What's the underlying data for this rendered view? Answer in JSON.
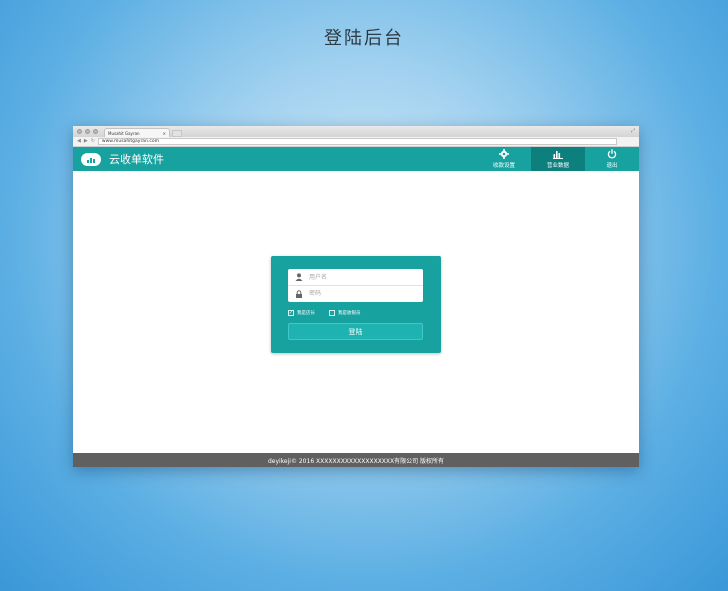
{
  "page": {
    "heading": "登陆后台"
  },
  "browser": {
    "tab_title": "Musahit Gayran",
    "tab_close": "×",
    "url": "www.musahitgayran.com"
  },
  "header": {
    "app_title": "云收单软件",
    "nav": [
      {
        "label": "收款设置",
        "icon": "gear-icon"
      },
      {
        "label": "营业数据",
        "icon": "bar-chart-icon"
      },
      {
        "label": "退出",
        "icon": "power-icon"
      }
    ],
    "active_nav": "营业数据"
  },
  "login": {
    "username_placeholder": "用户名",
    "password_placeholder": "密码",
    "role_owner": "我是店长",
    "role_cashier": "我是收银员",
    "owner_checked": true,
    "cashier_checked": false,
    "submit_label": "登陆"
  },
  "footer": {
    "text": "deyikeji©  2016  XXXXXXXXXXXXXXXXXXX有限公司 版权所有"
  },
  "colors": {
    "accent": "#17a2a0",
    "accent_dark": "#0d7f7d",
    "footer_bg": "#606060"
  }
}
